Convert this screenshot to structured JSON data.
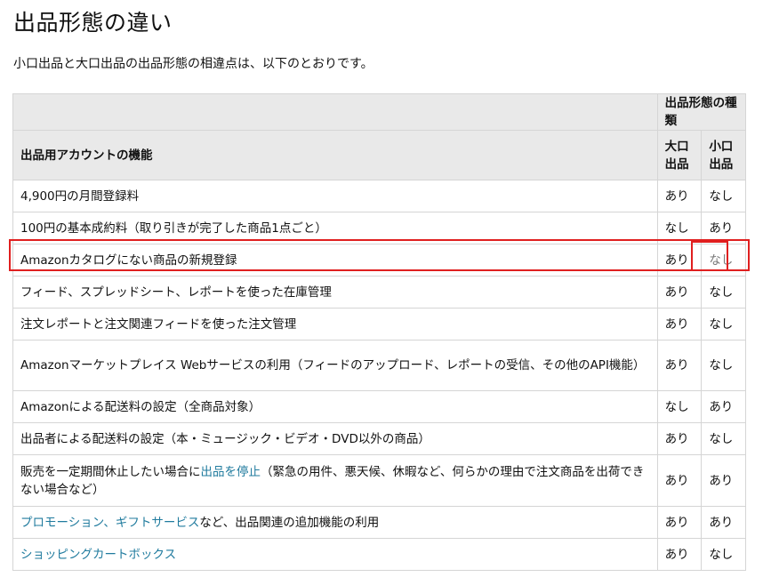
{
  "title": "出品形態の違い",
  "intro": "小口出品と大口出品の出品形態の相違点は、以下のとおりです。",
  "table": {
    "header_group": "出品形態の種類",
    "header_feature": "出品用アカウントの機能",
    "header_large": "大口出品",
    "header_small": "小口出品",
    "rows": [
      {
        "feature": "4,900円の月間登録料",
        "large": "あり",
        "small": "なし"
      },
      {
        "feature": "100円の基本成約料（取り引きが完了した商品1点ごと）",
        "large": "なし",
        "small": "あり"
      },
      {
        "feature": "Amazonカタログにない商品の新規登録",
        "large": "あり",
        "small": "なし"
      },
      {
        "feature": "フィード、スプレッドシート、レポートを使った在庫管理",
        "large": "あり",
        "small": "なし"
      },
      {
        "feature": "注文レポートと注文関連フィードを使った注文管理",
        "large": "あり",
        "small": "なし"
      },
      {
        "feature": "Amazonマーケットプレイス Webサービスの利用（フィードのアップロード、レポートの受信、その他のAPI機能）",
        "large": "あり",
        "small": "なし"
      },
      {
        "feature": "Amazonによる配送料の設定（全商品対象）",
        "large": "なし",
        "small": "あり"
      },
      {
        "feature": "出品者による配送料の設定（本・ミュージック・ビデオ・DVD以外の商品）",
        "large": "あり",
        "small": "なし"
      },
      {
        "feature_pre": "販売を一定期間休止したい場合に",
        "feature_link": "出品を停止",
        "feature_post": "（緊急の用件、悪天候、休暇など、何らかの理由で注文商品を出荷できない場合など）",
        "large": "あり",
        "small": "あり"
      },
      {
        "feature_link": "プロモーション、ギフトサービス",
        "feature_post": "など、出品関連の追加機能の利用",
        "large": "あり",
        "small": "あり"
      },
      {
        "feature_link": "ショッピングカートボックス",
        "large": "あり",
        "small": "なし"
      }
    ]
  },
  "highlight_color": "#e01f1f",
  "link_color": "#207b9e"
}
